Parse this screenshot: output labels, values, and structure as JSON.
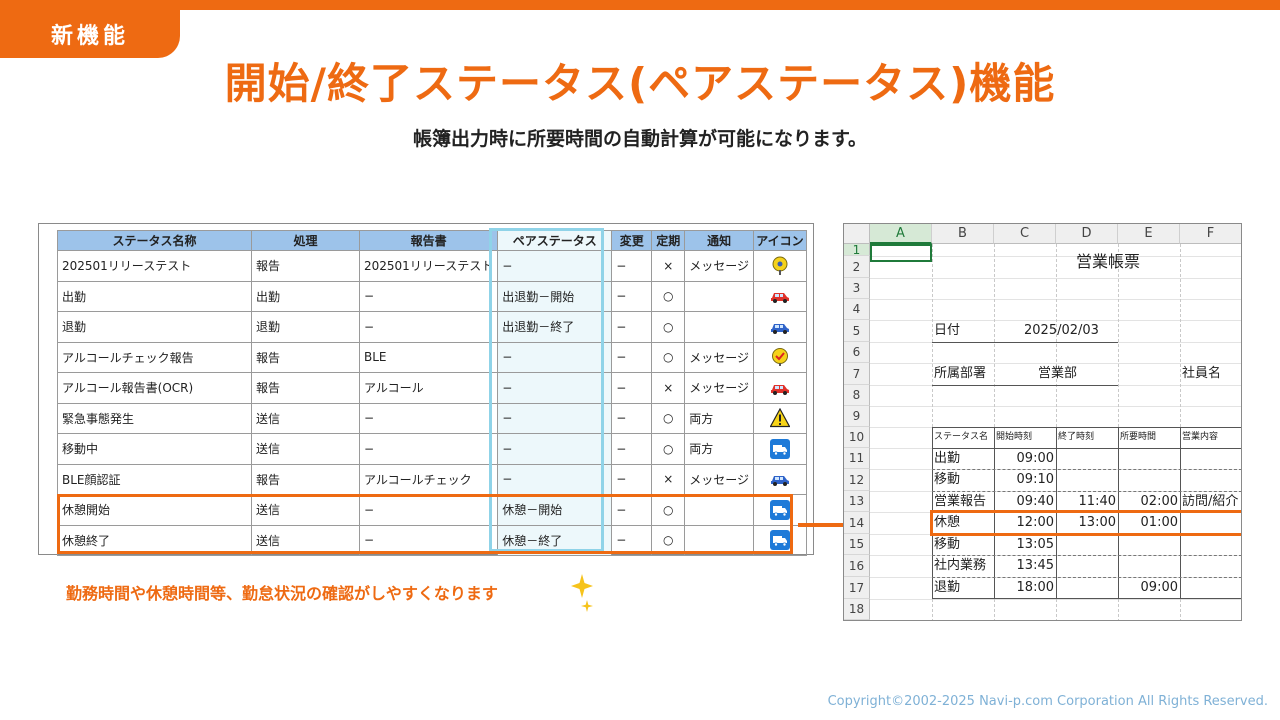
{
  "badge": "新機能",
  "title": "開始/終了ステータス(ペアステータス)機能",
  "subtitle": "帳簿出力時に所要時間の自動計算が可能になります。",
  "status_table": {
    "headers": [
      "ステータス名称",
      "処理",
      "報告書",
      "ペアステータス",
      "変更",
      "定期",
      "通知",
      "アイコン"
    ],
    "rows": [
      {
        "name": "202501リリーステスト",
        "proc": "報告",
        "report": "202501リリーステスト",
        "pair": "−",
        "change": "−",
        "periodic": "×",
        "notify": "メッセージ",
        "icon": "pin-icon"
      },
      {
        "name": "出勤",
        "proc": "出勤",
        "report": "−",
        "pair": "出退勤－開始",
        "change": "−",
        "periodic": "○",
        "notify": "",
        "icon": "red-car-icon"
      },
      {
        "name": "退勤",
        "proc": "退勤",
        "report": "−",
        "pair": "出退勤－終了",
        "change": "−",
        "periodic": "○",
        "notify": "",
        "icon": "blue-car-icon"
      },
      {
        "name": "アルコールチェック報告",
        "proc": "報告",
        "report": "BLE",
        "pair": "−",
        "change": "−",
        "periodic": "○",
        "notify": "メッセージ",
        "icon": "check-badge-icon"
      },
      {
        "name": "アルコール報告書(OCR)",
        "proc": "報告",
        "report": "アルコール",
        "pair": "−",
        "change": "−",
        "periodic": "×",
        "notify": "メッセージ",
        "icon": "red-car-icon"
      },
      {
        "name": "緊急事態発生",
        "proc": "送信",
        "report": "−",
        "pair": "−",
        "change": "−",
        "periodic": "○",
        "notify": "両方",
        "icon": "warning-icon"
      },
      {
        "name": "移動中",
        "proc": "送信",
        "report": "−",
        "pair": "−",
        "change": "−",
        "periodic": "○",
        "notify": "両方",
        "icon": "truck-icon"
      },
      {
        "name": "BLE顔認証",
        "proc": "報告",
        "report": "アルコールチェック",
        "pair": "−",
        "change": "−",
        "periodic": "×",
        "notify": "メッセージ",
        "icon": "blue-car-icon"
      },
      {
        "name": "休憩開始",
        "proc": "送信",
        "report": "−",
        "pair": "休憩－開始",
        "change": "−",
        "periodic": "○",
        "notify": "",
        "icon": "truck-icon"
      },
      {
        "name": "休憩終了",
        "proc": "送信",
        "report": "−",
        "pair": "休憩－終了",
        "change": "−",
        "periodic": "○",
        "notify": "",
        "icon": "truck-icon"
      }
    ]
  },
  "note": "勤務時間や休憩時間等、勤怠状況の確認がしやすくなります",
  "sheet": {
    "columns": [
      "A",
      "B",
      "C",
      "D",
      "E",
      "F"
    ],
    "rows": [
      "1",
      "2",
      "3",
      "4",
      "5",
      "6",
      "7",
      "8",
      "9",
      "10",
      "11",
      "12",
      "13",
      "14",
      "15",
      "16",
      "17",
      "18"
    ],
    "report_title": "営業帳票",
    "date_label": "日付",
    "date_value": "2025/02/03",
    "dept_label": "所属部署",
    "dept_value": "営業部",
    "employee_label": "社員名",
    "table_headers": [
      "ステータス名",
      "開始時刻",
      "終了時刻",
      "所要時間",
      "営業内容"
    ],
    "table_rows": [
      {
        "status": "出勤",
        "start": "09:00",
        "end": "",
        "duration": "",
        "content": ""
      },
      {
        "status": "移動",
        "start": "09:10",
        "end": "",
        "duration": "",
        "content": ""
      },
      {
        "status": "営業報告",
        "start": "09:40",
        "end": "11:40",
        "duration": "02:00",
        "content": "訪問/紹介"
      },
      {
        "status": "休憩",
        "start": "12:00",
        "end": "13:00",
        "duration": "01:00",
        "content": ""
      },
      {
        "status": "移動",
        "start": "13:05",
        "end": "",
        "duration": "",
        "content": ""
      },
      {
        "status": "社内業務",
        "start": "13:45",
        "end": "",
        "duration": "",
        "content": ""
      },
      {
        "status": "退勤",
        "start": "18:00",
        "end": "",
        "duration": "09:00",
        "content": ""
      }
    ]
  },
  "copyright": "Copyright©2002-2025 Navi-p.com Corporation All Rights Reserved.",
  "colors": {
    "accent": "#ee6a12",
    "header_blue": "#9dc3ea",
    "pair_cyan": "#8fd3e8"
  }
}
